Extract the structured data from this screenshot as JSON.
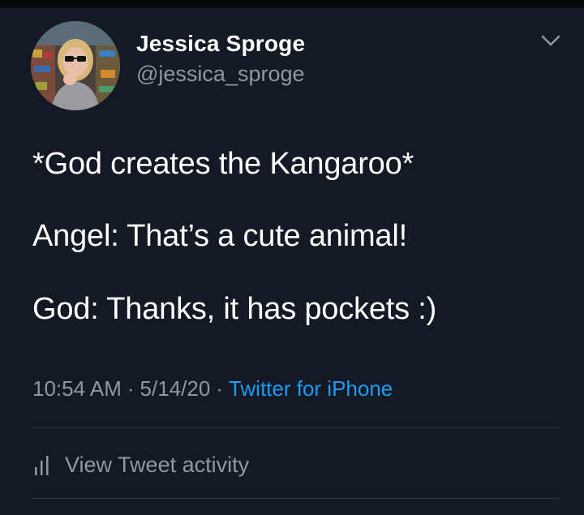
{
  "tweet": {
    "author": {
      "display_name": "Jessica Sproge",
      "handle": "@jessica_sproge"
    },
    "lines": [
      "*God creates the Kangaroo*",
      "Angel: That’s a cute animal!",
      "God: Thanks, it has pockets :)"
    ],
    "meta": {
      "time": "10:54 AM",
      "date": "5/14/20",
      "separator": "·",
      "source": "Twitter for iPhone"
    },
    "activity_label": "View Tweet activity",
    "icons": {
      "menu": "chevron-down-icon",
      "activity": "bar-chart-icon"
    }
  },
  "colors": {
    "background": "#141a25",
    "text": "#ffffff",
    "secondary_text": "#8b98a5",
    "link": "#1d9bf0",
    "divider": "#2f3640"
  }
}
